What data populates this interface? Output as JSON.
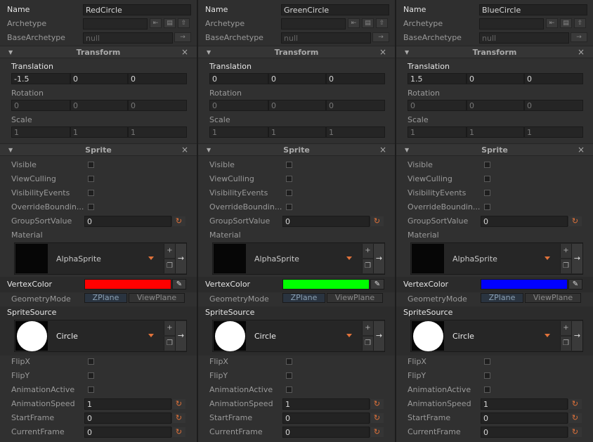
{
  "labels": {
    "name": "Name",
    "archetype": "Archetype",
    "base_archetype": "BaseArchetype",
    "null_text": "null",
    "transform": "Transform",
    "translation": "Translation",
    "rotation": "Rotation",
    "scale": "Scale",
    "sprite": "Sprite",
    "visible": "Visible",
    "view_culling": "ViewCulling",
    "visibility_events": "VisibilityEvents",
    "override_bounding": "OverrideBoundin...",
    "group_sort_value": "GroupSortValue",
    "material": "Material",
    "vertex_color": "VertexColor",
    "geometry_mode": "GeometryMode",
    "zplane": "ZPlane",
    "viewplane": "ViewPlane",
    "sprite_source": "SpriteSource",
    "flip_x": "FlipX",
    "flip_y": "FlipY",
    "animation_active": "AnimationActive",
    "animation_speed": "AnimationSpeed",
    "start_frame": "StartFrame",
    "current_frame": "CurrentFrame"
  },
  "panels": [
    {
      "name": "RedCircle",
      "translation": [
        "-1.5",
        "0",
        "0"
      ],
      "rotation": [
        "0",
        "0",
        "0"
      ],
      "scale": [
        "1",
        "1",
        "1"
      ],
      "group_sort_value": "0",
      "material": "AlphaSprite",
      "vertex_color": "#ff0000",
      "sprite_source": "Circle",
      "animation_speed": "1",
      "start_frame": "0",
      "current_frame": "0"
    },
    {
      "name": "GreenCircle",
      "translation": [
        "0",
        "0",
        "0"
      ],
      "rotation": [
        "0",
        "0",
        "0"
      ],
      "scale": [
        "1",
        "1",
        "1"
      ],
      "group_sort_value": "0",
      "material": "AlphaSprite",
      "vertex_color": "#00ff00",
      "sprite_source": "Circle",
      "animation_speed": "1",
      "start_frame": "0",
      "current_frame": "0"
    },
    {
      "name": "BlueCircle",
      "translation": [
        "1.5",
        "0",
        "0"
      ],
      "rotation": [
        "0",
        "0",
        "0"
      ],
      "scale": [
        "1",
        "1",
        "1"
      ],
      "group_sort_value": "0",
      "material": "AlphaSprite",
      "vertex_color": "#0000ff",
      "sprite_source": "Circle",
      "animation_speed": "1",
      "start_frame": "0",
      "current_frame": "0"
    }
  ],
  "colors": {
    "accent_orange": "#e0723a",
    "panel_bg": "#2f2f2f"
  },
  "icons": {
    "collapse": "triangle-down-icon",
    "close": "close-icon",
    "refresh": "refresh-icon",
    "eyedropper": "eyedropper-icon",
    "add": "plus-icon",
    "copy": "copy-icon",
    "goto": "arrow-right-icon",
    "dropdown": "dropdown-icon"
  }
}
